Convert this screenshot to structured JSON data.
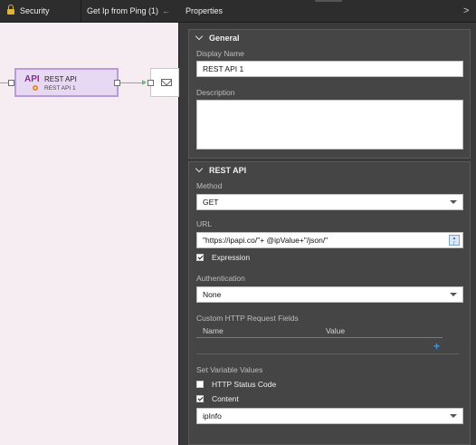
{
  "tabs": {
    "security": "Security",
    "get_ip": "Get Ip from Ping (1)",
    "back_arrow": "←",
    "properties": "Properties",
    "collapse_arrow": ">"
  },
  "canvas": {
    "node": {
      "badge": "API",
      "title": "REST API",
      "subtitle": "REST API 1"
    }
  },
  "general": {
    "header": "General",
    "display_name_label": "Display Name",
    "display_name_value": "REST API 1",
    "description_label": "Description",
    "description_value": ""
  },
  "rest_api": {
    "header": "REST API",
    "method_label": "Method",
    "method_value": "GET",
    "url_label": "URL",
    "url_value": "\"https://ipapi.co/\"+ @ipValue+\"/json/\"",
    "expression_label": "Expression",
    "expression_checked": true,
    "auth_label": "Authentication",
    "auth_value": "None",
    "custom_fields_label": "Custom HTTP Request Fields",
    "columns": [
      "Name",
      "Value"
    ],
    "set_vars_label": "Set Variable Values",
    "http_status_label": "HTTP Status Code",
    "http_status_checked": false,
    "content_label": "Content",
    "content_checked": true,
    "content_var_value": "ipInfo"
  },
  "icons": {
    "lock": "lock-icon",
    "gear": "gear-icon",
    "mail": "mail-icon",
    "add": "plus-icon",
    "expression_editor": "url-expression-icon"
  },
  "colors": {
    "accent": "#3b9be8",
    "node_border": "#b99bd8",
    "wire": "#6cc26c"
  }
}
